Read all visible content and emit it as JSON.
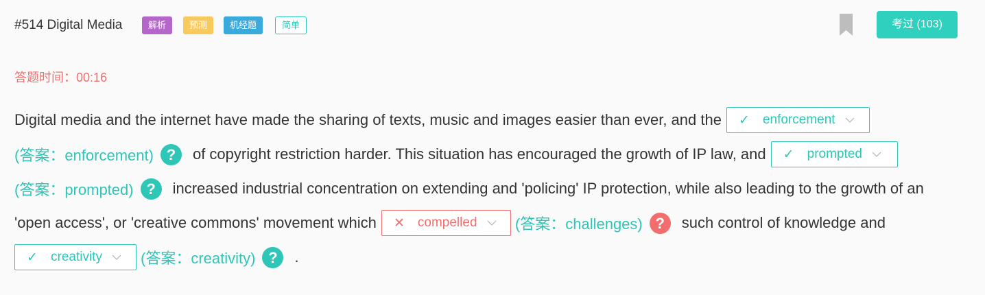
{
  "header": {
    "title": "#514 Digital Media",
    "tags": [
      "解析",
      "预测",
      "机经题",
      "简单"
    ],
    "pass_button": "考过 (103)"
  },
  "timer": {
    "label": "答题时间：",
    "value": "00:16"
  },
  "passage": {
    "seg1": "Digital media and the internet have made the sharing of texts, music and images easier than ever, and the",
    "seg2": "of copyright restriction harder. This situation has encouraged the growth of IP law, and",
    "seg3": "increased industrial concentration on extending and 'policing' IP protection, while also leading to the growth of an",
    "seg4": "'open access', or 'creative commons' movement which",
    "seg5": "such control of knowledge and",
    "seg6": "."
  },
  "blanks": [
    {
      "selected": "enforcement",
      "answer": "(答案：enforcement)",
      "correct": true,
      "mark": "✓"
    },
    {
      "selected": "prompted",
      "answer": "(答案：prompted)",
      "correct": true,
      "mark": "✓"
    },
    {
      "selected": "compelled",
      "answer": "(答案：challenges)",
      "correct": false,
      "mark": "✕"
    },
    {
      "selected": "creativity",
      "answer": "(答案：creativity)",
      "correct": true,
      "mark": "✓"
    }
  ],
  "help_glyph": "?",
  "icons": {
    "bookmark": "bookmark-icon",
    "check": "check-icon",
    "cross": "cross-icon",
    "chevron": "chevron-down-icon",
    "help": "question-icon"
  },
  "colors": {
    "accent": "#2dc6b7",
    "error": "#f26e6e",
    "tag_jiexi": "#b467c9",
    "tag_yuce": "#f8c95c",
    "tag_jijing": "#3aa9dc"
  }
}
